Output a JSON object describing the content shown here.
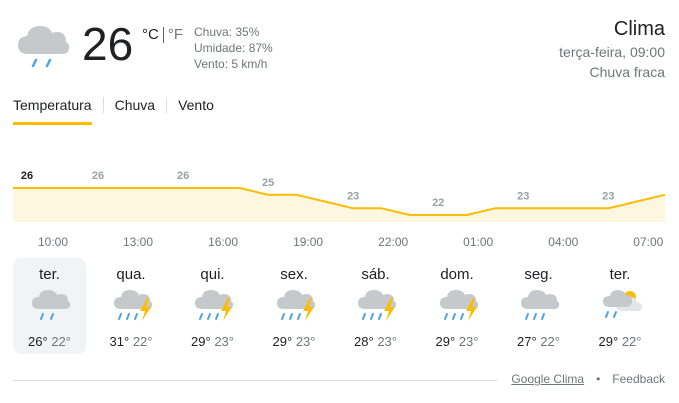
{
  "current": {
    "temperature": "26",
    "unit_c": "°C",
    "unit_f": "°F",
    "icon": "rain-cloud-icon",
    "chuva": "Chuva: 35%",
    "umidade": "Umidade: 87%",
    "vento": "Vento: 5 km/h"
  },
  "header": {
    "title": "Clima",
    "datetime": "terça-feira, 09:00",
    "condition": "Chuva fraca"
  },
  "tabs": [
    {
      "label": "Temperatura",
      "active": true
    },
    {
      "label": "Chuva",
      "active": false
    },
    {
      "label": "Vento",
      "active": false
    }
  ],
  "chart_data": {
    "type": "area",
    "x": [
      "10:00",
      "11:00",
      "12:00",
      "13:00",
      "14:00",
      "15:00",
      "16:00",
      "17:00",
      "18:00",
      "19:00",
      "20:00",
      "21:00",
      "22:00",
      "23:00",
      "00:00",
      "01:00",
      "02:00",
      "03:00",
      "04:00",
      "05:00",
      "06:00",
      "07:00",
      "08:00",
      "09:00"
    ],
    "y": [
      26,
      26,
      26,
      26,
      26,
      26,
      26,
      26,
      26,
      25,
      25,
      24,
      23,
      23,
      22,
      22,
      22,
      23,
      23,
      23,
      23,
      23,
      24,
      25
    ],
    "x_tick_labels": [
      "10:00",
      "13:00",
      "16:00",
      "19:00",
      "22:00",
      "01:00",
      "04:00",
      "07:00"
    ],
    "data_labels": [
      "26",
      "26",
      "26",
      "25",
      "23",
      "22",
      "23",
      "23"
    ],
    "fill_color": "#fef7e0",
    "line_color": "#fbbc04"
  },
  "days": [
    {
      "name": "ter.",
      "hi": "26°",
      "lo": "22°",
      "icon": "rain-cloud-icon",
      "selected": true
    },
    {
      "name": "qua.",
      "hi": "31°",
      "lo": "22°",
      "icon": "thunderstorm-icon",
      "selected": false
    },
    {
      "name": "qui.",
      "hi": "29°",
      "lo": "23°",
      "icon": "thunderstorm-icon",
      "selected": false
    },
    {
      "name": "sex.",
      "hi": "29°",
      "lo": "23°",
      "icon": "thunderstorm-icon",
      "selected": false
    },
    {
      "name": "sáb.",
      "hi": "28°",
      "lo": "23°",
      "icon": "thunderstorm-icon",
      "selected": false
    },
    {
      "name": "dom.",
      "hi": "29°",
      "lo": "23°",
      "icon": "thunderstorm-icon",
      "selected": false
    },
    {
      "name": "seg.",
      "hi": "27°",
      "lo": "22°",
      "icon": "rain-cloud-icon",
      "selected": false
    },
    {
      "name": "ter.",
      "hi": "29°",
      "lo": "22°",
      "icon": "rain-cloud-sun-icon",
      "selected": false
    }
  ],
  "footer": {
    "source": "Google Clima",
    "separator": "•",
    "feedback": "Feedback"
  }
}
